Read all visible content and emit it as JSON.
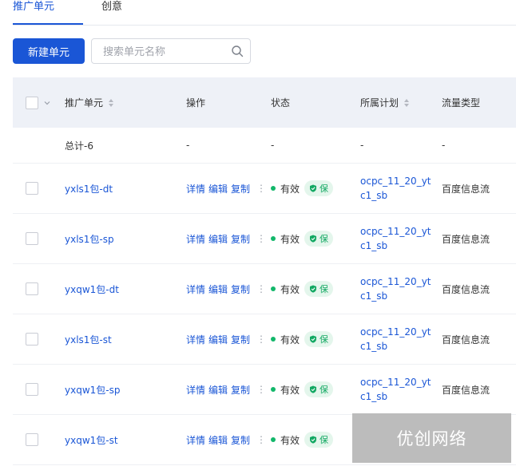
{
  "tabs": [
    {
      "label": "推广单元",
      "active": true
    },
    {
      "label": "创意",
      "active": false
    }
  ],
  "toolbar": {
    "new_button": "新建单元",
    "search_placeholder": "搜索单元名称"
  },
  "table": {
    "headers": {
      "name": "推广单元",
      "ops": "操作",
      "status": "状态",
      "plan": "所属计划",
      "type": "流量类型"
    },
    "total": {
      "label": "总计-6",
      "ops": "-",
      "status": "-",
      "plan": "-",
      "type": "-"
    },
    "op_labels": {
      "detail": "详情",
      "edit": "编辑",
      "copy": "复制",
      "more": "⋮"
    },
    "rows": [
      {
        "name": "yxls1包-dt",
        "status": "有效",
        "badge": "保",
        "plan": "ocpc_11_20_ytc1_sb",
        "type": "百度信息流"
      },
      {
        "name": "yxls1包-sp",
        "status": "有效",
        "badge": "保",
        "plan": "ocpc_11_20_ytc1_sb",
        "type": "百度信息流"
      },
      {
        "name": "yxqw1包-dt",
        "status": "有效",
        "badge": "保",
        "plan": "ocpc_11_20_ytc1_sb",
        "type": "百度信息流"
      },
      {
        "name": "yxls1包-st",
        "status": "有效",
        "badge": "保",
        "plan": "ocpc_11_20_ytc1_sb",
        "type": "百度信息流"
      },
      {
        "name": "yxqw1包-sp",
        "status": "有效",
        "badge": "保",
        "plan": "ocpc_11_20_ytc1_sb",
        "type": "百度信息流"
      },
      {
        "name": "yxqw1包-st",
        "status": "有效",
        "badge": "保",
        "plan": "",
        "type": ""
      }
    ]
  },
  "watermark": "优创网络",
  "colors": {
    "primary": "#1a56d6",
    "success": "#12b76a",
    "header_bg": "#eef1f7"
  }
}
